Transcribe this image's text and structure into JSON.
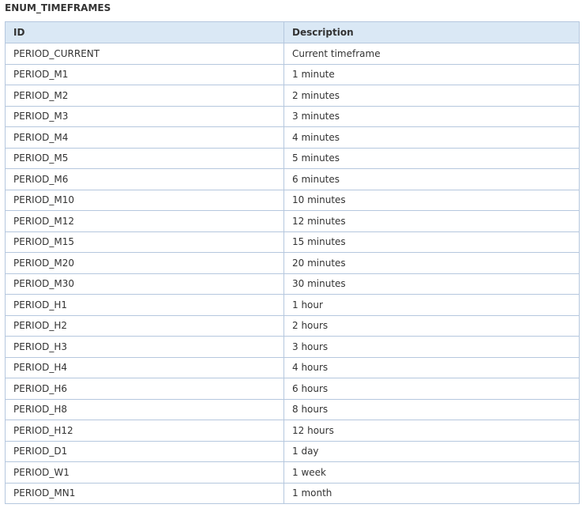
{
  "title": "ENUM_TIMEFRAMES",
  "columns": {
    "id": "ID",
    "description": "Description"
  },
  "rows": [
    {
      "id": "PERIOD_CURRENT",
      "description": "Current timeframe"
    },
    {
      "id": "PERIOD_M1",
      "description": "1 minute"
    },
    {
      "id": "PERIOD_M2",
      "description": "2 minutes"
    },
    {
      "id": "PERIOD_M3",
      "description": "3 minutes"
    },
    {
      "id": "PERIOD_M4",
      "description": "4 minutes"
    },
    {
      "id": "PERIOD_M5",
      "description": "5 minutes"
    },
    {
      "id": "PERIOD_M6",
      "description": "6 minutes"
    },
    {
      "id": "PERIOD_M10",
      "description": "10 minutes"
    },
    {
      "id": "PERIOD_M12",
      "description": "12 minutes"
    },
    {
      "id": "PERIOD_M15",
      "description": "15 minutes"
    },
    {
      "id": "PERIOD_M20",
      "description": "20 minutes"
    },
    {
      "id": "PERIOD_M30",
      "description": "30 minutes"
    },
    {
      "id": "PERIOD_H1",
      "description": "1 hour"
    },
    {
      "id": "PERIOD_H2",
      "description": "2 hours"
    },
    {
      "id": "PERIOD_H3",
      "description": "3 hours"
    },
    {
      "id": "PERIOD_H4",
      "description": "4 hours"
    },
    {
      "id": "PERIOD_H6",
      "description": "6 hours"
    },
    {
      "id": "PERIOD_H8",
      "description": "8 hours"
    },
    {
      "id": "PERIOD_H12",
      "description": "12 hours"
    },
    {
      "id": "PERIOD_D1",
      "description": "1 day"
    },
    {
      "id": "PERIOD_W1",
      "description": "1 week"
    },
    {
      "id": "PERIOD_MN1",
      "description": "1 month"
    }
  ],
  "colors": {
    "header_background": "#dae8f5",
    "border": "#b5c7de",
    "text": "#333333"
  }
}
